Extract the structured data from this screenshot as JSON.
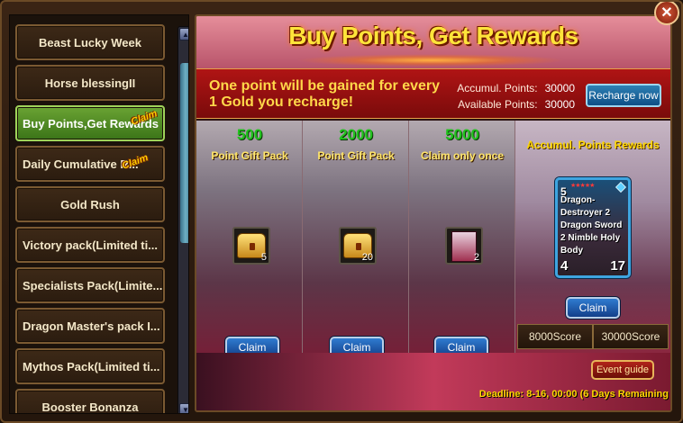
{
  "sidebar": {
    "items": [
      {
        "label": "Beast Lucky Week"
      },
      {
        "label": "Horse blessingII"
      },
      {
        "label": "Buy Points,Get Rewards",
        "badge": "Claim"
      },
      {
        "label": "Daily Cumulative R...",
        "badge": "Claim"
      },
      {
        "label": "Gold Rush"
      },
      {
        "label": "Victory pack(Limited ti..."
      },
      {
        "label": "Specialists Pack(Limite..."
      },
      {
        "label": "Dragon Master's pack I..."
      },
      {
        "label": "Mythos Pack(Limited ti..."
      },
      {
        "label": "Booster Bonanza"
      }
    ]
  },
  "header": {
    "title": "Buy Points, Get Rewards"
  },
  "info": {
    "message": "One point will be gained for every 1 Gold you recharge!",
    "accumul_label": "Accumul. Points:",
    "accumul_value": "30000",
    "available_label": "Available Points:",
    "available_value": "30000",
    "recharge_label": "Recharge now"
  },
  "packs": [
    {
      "points": "500",
      "title": "Point Gift Pack",
      "count": "5",
      "claim": "Claim"
    },
    {
      "points": "2000",
      "title": "Point Gift Pack",
      "count": "20",
      "claim": "Claim"
    },
    {
      "points": "5000",
      "title": "Claim only once",
      "count": "2",
      "claim": "Claim"
    }
  ],
  "reward": {
    "title": "Accumul. Points Rewards",
    "card": {
      "level": "5",
      "name": "Dragon-Destroyer 2 Dragon Sword 2 Nimble Holy Body",
      "attack": "4",
      "health": "17"
    },
    "claim": "Claim",
    "scores": [
      "8000Score",
      "30000Score"
    ]
  },
  "footer": {
    "event_guide": "Event guide",
    "deadline": "Deadline: 8-16, 00:00 (6 Days Remaining"
  },
  "close_symbol": "✕"
}
